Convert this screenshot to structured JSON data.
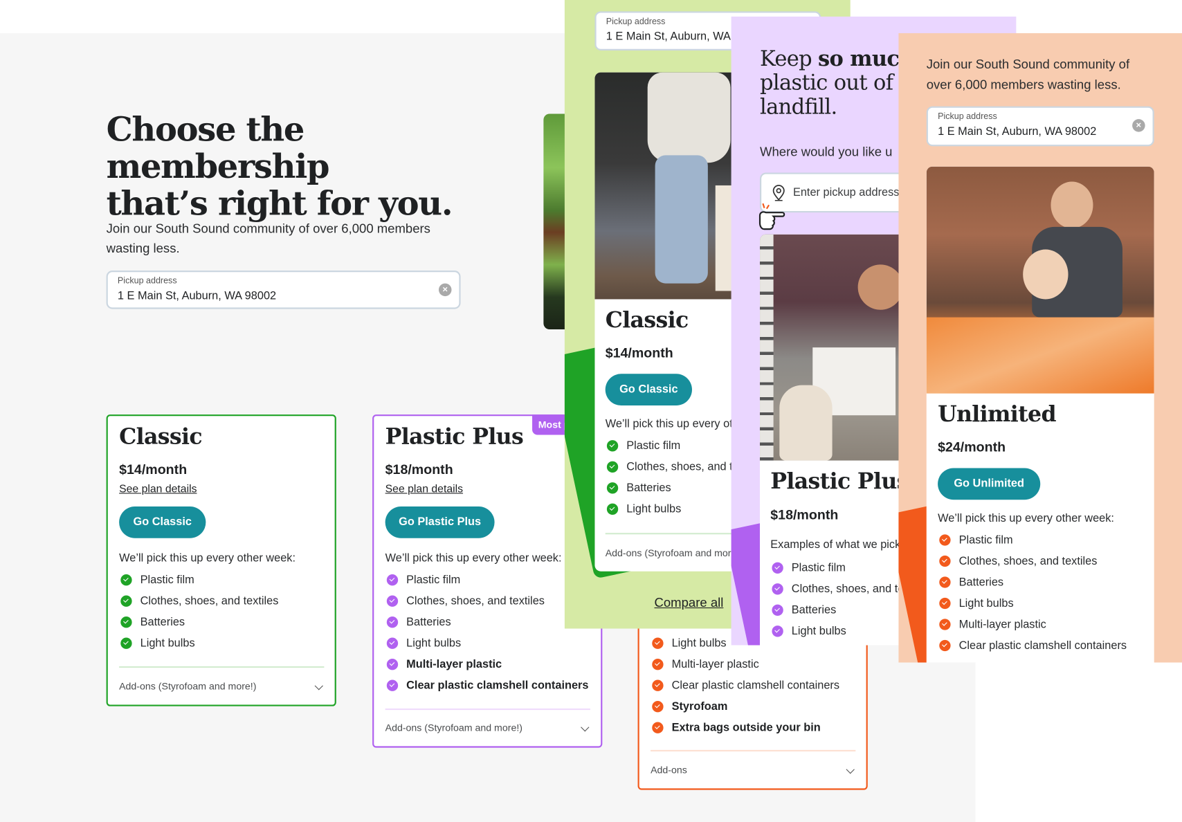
{
  "desktop": {
    "headline": [
      "Choose the membership",
      "that’s right for you."
    ],
    "lead": [
      "Join our South Sound community of over 6,000 members",
      "wasting less."
    ],
    "address": {
      "label": "Pickup address",
      "value": "1 E Main St, Auburn, WA 98002",
      "clear_icon": "×"
    },
    "plans": [
      {
        "name": "Classic",
        "price": "$14/month",
        "details_link": "See plan details",
        "cta": "Go Classic",
        "note": "We’ll pick this up every other week:",
        "items": [
          "Plastic film",
          "Clothes, shoes, and textiles",
          "Batteries",
          "Light bulbs"
        ],
        "addons": "Add-ons (Styrofoam and more!)",
        "accent": "#1fa326"
      },
      {
        "name": "Plastic Plus",
        "price": "$18/month",
        "details_link": "See plan details",
        "badge": "Most p",
        "cta": "Go Plastic Plus",
        "note": "We’ll pick this up every other week:",
        "items": [
          "Plastic film",
          "Clothes, shoes, and textiles",
          "Batteries",
          "Light bulbs"
        ],
        "bold_items": [
          "Multi-layer plastic",
          "Clear plastic clamshell containers"
        ],
        "addons": "Add-ons (Styrofoam and more!)",
        "accent": "#b061f0"
      },
      {
        "name": "Unlimited",
        "items": [
          "Light bulbs",
          "Multi-layer plastic",
          "Clear plastic clamshell containers"
        ],
        "bold_items": [
          "Styrofoam",
          "Extra bags outside your bin"
        ],
        "addons": "Add-ons",
        "accent": "#f25a1c"
      }
    ]
  },
  "mobile_green": {
    "bg": "#d6eaa5",
    "address": {
      "label": "Pickup address",
      "value": "1 E Main St, Auburn, WA"
    },
    "plan": {
      "name": "Classic",
      "price": "$14/month",
      "cta": "Go Classic",
      "note": "We’ll pick this up every ot",
      "items": [
        "Plastic film",
        "Clothes, shoes, and te",
        "Batteries",
        "Light bulbs"
      ],
      "addons": "Add-ons (Styrofoam and mor"
    },
    "compare_link": "Compare all"
  },
  "mobile_purple": {
    "bg": "#ead6ff",
    "headline": {
      "pre": "Keep ",
      "bold": "so much",
      "line2": "plastic out of t",
      "line3": "landfill."
    },
    "question": "Where would you like u",
    "address_placeholder": "Enter pickup address",
    "plan": {
      "name": "Plastic Plus",
      "price": "$18/month",
      "note": "Examples of what we pick",
      "items": [
        "Plastic film",
        "Clothes, shoes, and te",
        "Batteries",
        "Light bulbs"
      ]
    }
  },
  "mobile_orange": {
    "bg": "#f8ccb0",
    "lead": [
      "Join our South Sound community of",
      "over 6,000 members wasting less."
    ],
    "address": {
      "label": "Pickup address",
      "value": "1 E Main St, Auburn, WA 98002",
      "clear_icon": "×"
    },
    "plan": {
      "name": "Unlimited",
      "price": "$24/month",
      "cta": "Go Unlimited",
      "note": "We’ll pick this up every other week:",
      "items": [
        "Plastic film",
        "Clothes, shoes, and textiles",
        "Batteries",
        "Light bulbs",
        "Multi-layer plastic",
        "Clear plastic clamshell containers"
      ]
    }
  },
  "colors": {
    "teal": "#178f9c",
    "green": "#1fa326",
    "purple": "#b061f0",
    "orange": "#f25a1c"
  }
}
